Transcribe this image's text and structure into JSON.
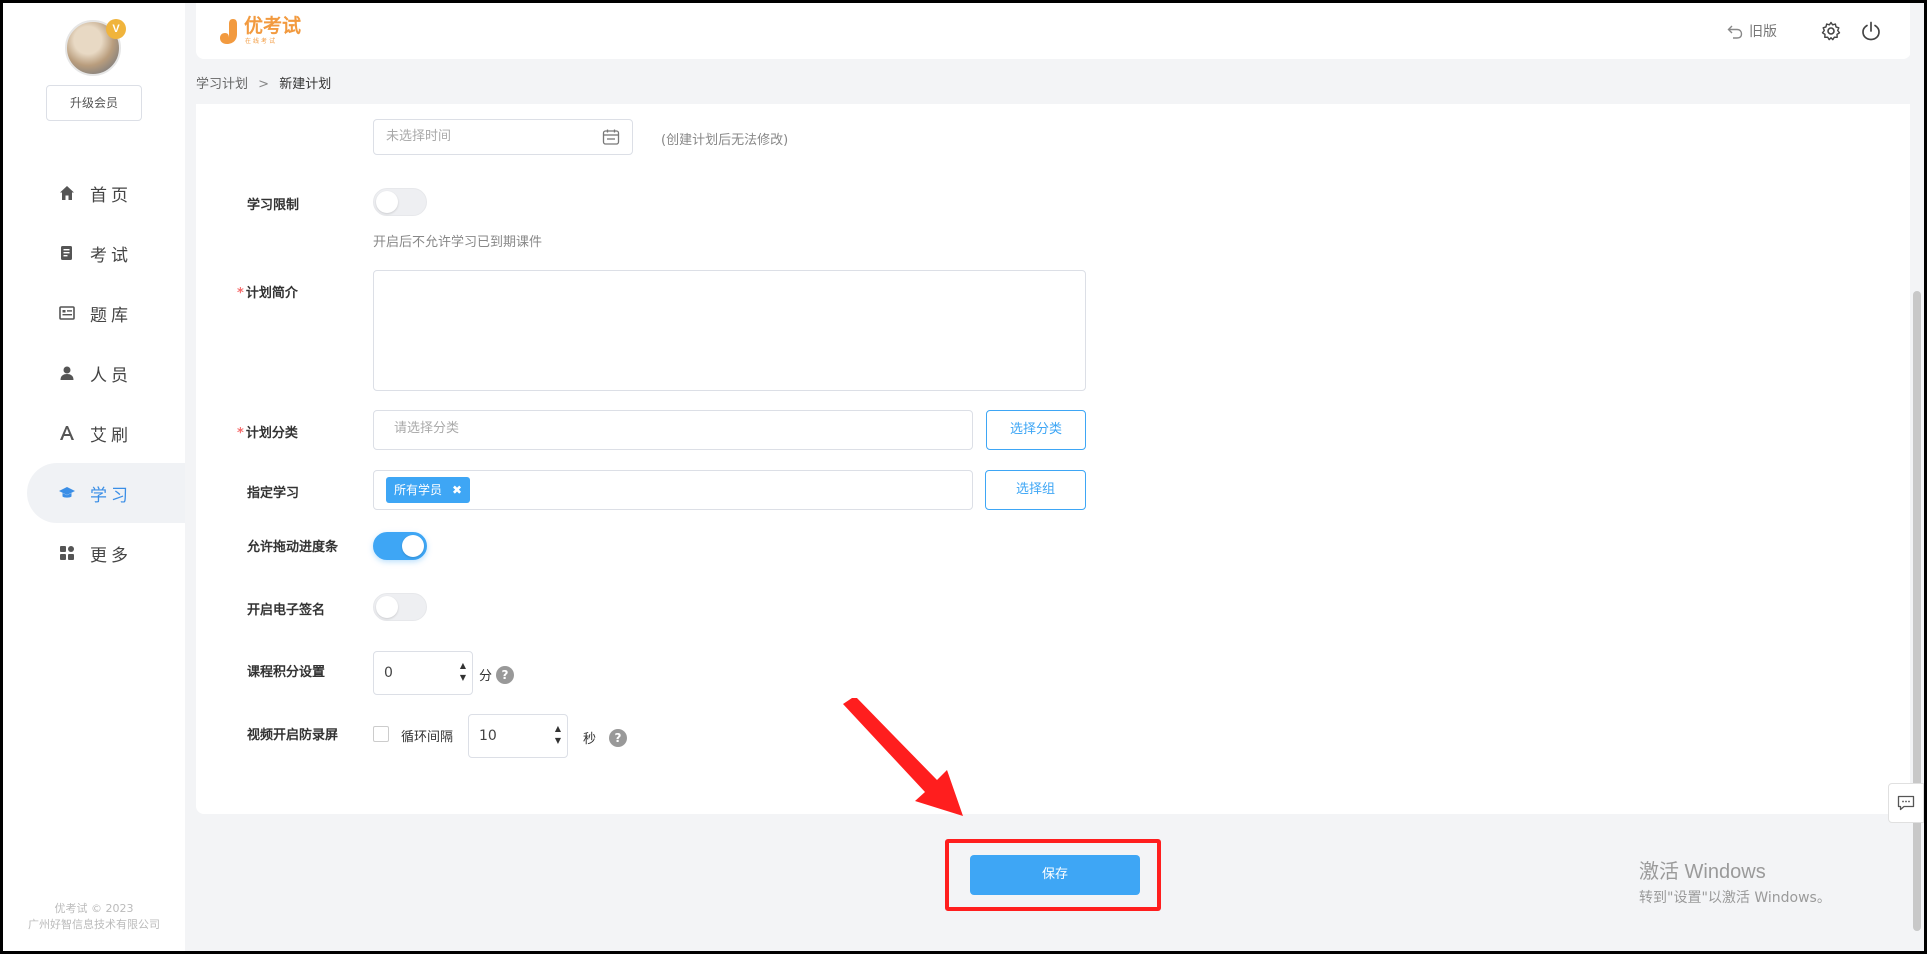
{
  "sidebar": {
    "upgrade_label": "升级会员",
    "vip_badge": "V",
    "items": [
      {
        "label": "首页",
        "icon": "home-icon"
      },
      {
        "label": "考试",
        "icon": "exam-icon"
      },
      {
        "label": "题库",
        "icon": "question-bank-icon"
      },
      {
        "label": "人员",
        "icon": "user-icon"
      },
      {
        "label": "艾刷",
        "icon": "font-a-icon"
      },
      {
        "label": "学习",
        "icon": "graduation-cap-icon",
        "active": true
      },
      {
        "label": "更多",
        "icon": "grid-icon"
      }
    ],
    "footer_line1": "优考试 © 2023",
    "footer_line2": "广州好智信息技术有限公司"
  },
  "header": {
    "logo_text": "优考试",
    "logo_sub": "在线考试",
    "old_version_label": "旧版"
  },
  "breadcrumb": {
    "parent": "学习计划",
    "separator": ">",
    "current": "新建计划"
  },
  "form": {
    "date_placeholder": "未选择时间",
    "date_hint": "(创建计划后无法修改)",
    "study_limit_label": "学习限制",
    "study_limit_on": false,
    "study_limit_hint": "开启后不允许学习已到期课件",
    "intro_label": "计划简介",
    "required_mark": "*",
    "category_label": "计划分类",
    "category_placeholder": "请选择分类",
    "category_button": "选择分类",
    "assign_label": "指定学习",
    "assign_tag": "所有学员",
    "assign_tag_close": "✖",
    "assign_button": "选择组",
    "drag_progress_label": "允许拖动进度条",
    "drag_progress_on": true,
    "signature_label": "开启电子签名",
    "signature_on": false,
    "points_label": "课程积分设置",
    "points_value": "0",
    "points_unit": "分",
    "help_mark": "?",
    "anti_record_label": "视频开启防录屏",
    "loop_label": "循环间隔",
    "loop_value": "10",
    "loop_unit": "秒"
  },
  "save_label": "保存",
  "watermark": {
    "line1": "激活 Windows",
    "line2": "转到\"设置\"以激活 Windows。"
  },
  "colors": {
    "accent": "#3ea6f5",
    "highlight": "#ff1e1e",
    "logo": "#f29a3f"
  }
}
